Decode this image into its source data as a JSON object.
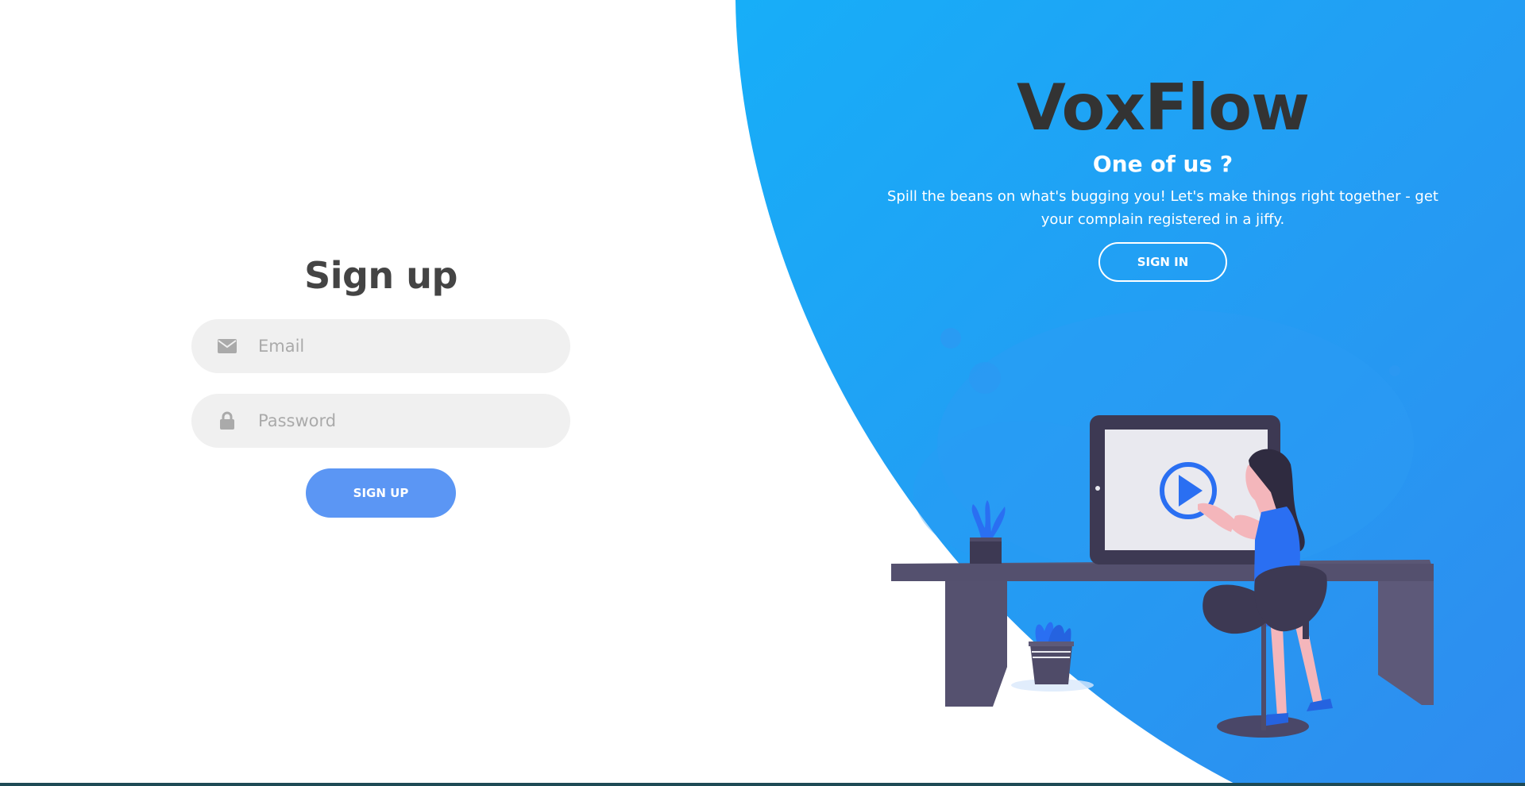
{
  "signup": {
    "title": "Sign up",
    "email_placeholder": "Email",
    "password_placeholder": "Password",
    "button_label": "SIGN UP"
  },
  "promo": {
    "brand": "VoxFlow",
    "subtitle": "One of us ?",
    "description": "Spill the beans on what's bugging you! Let's make things right together - get your complain registered in a jiffy.",
    "signin_label": "SIGN IN"
  },
  "colors": {
    "panel_top": "#1aa9f7",
    "panel_bottom": "#2a8ff0",
    "button_accent": "#5b96f4",
    "field_bg": "#f0f0f0"
  },
  "icons": {
    "email": "envelope-icon",
    "password": "lock-icon",
    "illustration_play": "play-icon"
  }
}
